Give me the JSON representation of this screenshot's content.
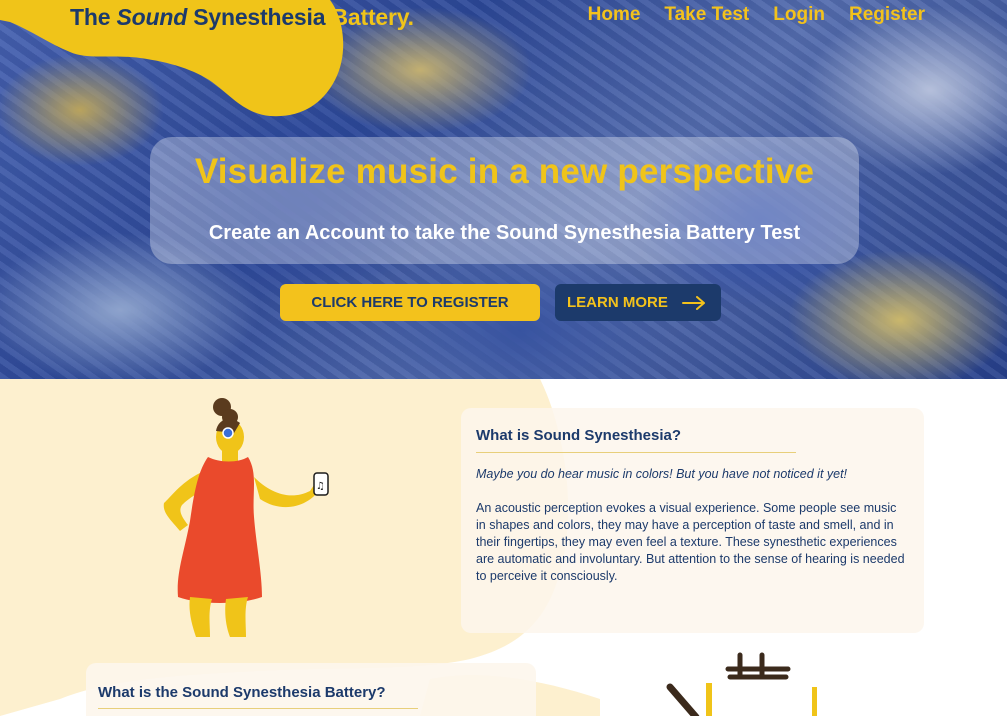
{
  "header": {
    "brand_the": "The",
    "brand_sound": "Sound",
    "brand_synesthesia": "Synesthesia",
    "brand_battery": "Battery."
  },
  "nav": {
    "items": [
      {
        "label": "Home"
      },
      {
        "label": "Take Test"
      },
      {
        "label": "Login"
      },
      {
        "label": "Register"
      }
    ]
  },
  "hero": {
    "title": "Visualize music in a new perspective",
    "subtitle": "Create an Account to take the Sound Synesthesia Battery Test",
    "register_button": "CLICK HERE TO REGISTER",
    "learn_more_button": "LEARN MORE"
  },
  "section_what_is": {
    "title": "What is Sound Synesthesia?",
    "tagline": "Maybe you do hear music in colors! But you have not noticed it yet!",
    "body": "An acoustic perception evokes a visual experience. Some people see music in shapes and colors, they may have a perception of taste and smell, and in their fingertips, they may even feel a texture. These synesthetic experiences are automatic and involuntary. But attention to the sense of hearing is needed to perceive it consciously."
  },
  "section_battery": {
    "title": "What is the Sound Synesthesia Battery?"
  },
  "colors": {
    "brand_navy": "#1c3a6b",
    "brand_yellow": "#f3c21c",
    "cream": "#fdf0cf",
    "dress_red": "#ea4a2c"
  },
  "icons": {
    "arrow": "arrow-right-icon",
    "music_phone": "music-note-icon"
  }
}
